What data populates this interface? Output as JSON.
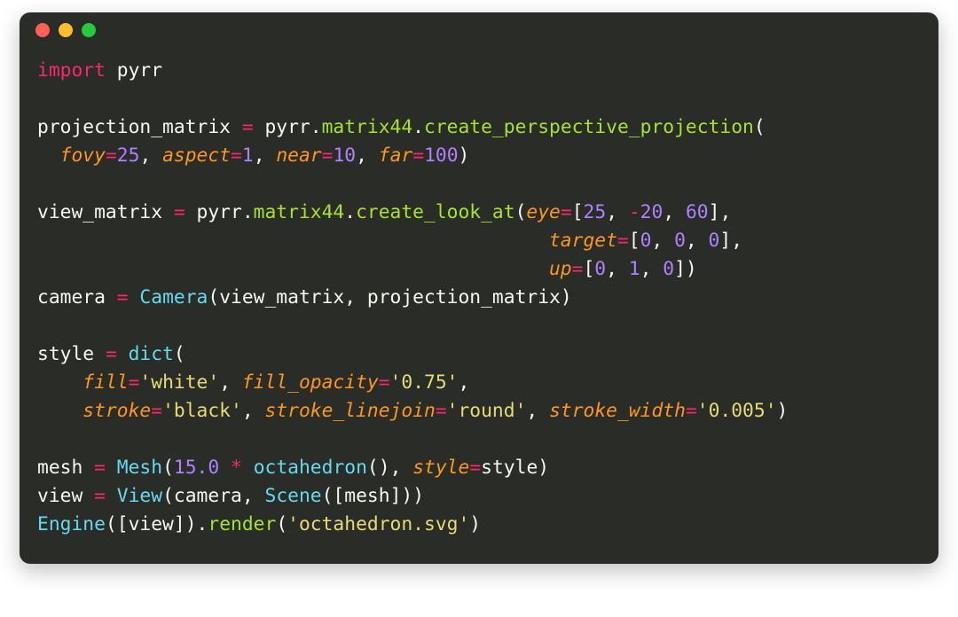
{
  "window": {
    "dots": [
      "red",
      "yellow",
      "green"
    ]
  },
  "code": {
    "kw_import": "import",
    "mod_pyrr": "pyrr",
    "var_projection": "projection_matrix",
    "op_eq": "=",
    "pyrr_ref": "pyrr",
    "dot": ".",
    "attr_matrix44": "matrix44",
    "call_create_perspective": "create_perspective_projection",
    "open_paren": "(",
    "close_paren": ")",
    "comma_sp": ", ",
    "param_fovy": "fovy",
    "num_25": "25",
    "param_aspect": "aspect",
    "num_1": "1",
    "param_near": "near",
    "num_10": "10",
    "param_far": "far",
    "num_100": "100",
    "var_view": "view_matrix",
    "call_create_lookat": "create_look_at",
    "param_eye": "eye",
    "bracket_open": "[",
    "bracket_close": "]",
    "num_neg20": "-20",
    "num_60": "60",
    "pad_target": "                                             ",
    "param_target": "target",
    "num_0": "0",
    "pad_up": "                                             ",
    "param_up": "up",
    "var_camera": "camera",
    "cls_Camera": "Camera",
    "var_style": "style",
    "call_dict": "dict",
    "indent_style": "    ",
    "param_fill": "fill",
    "str_white": "'white'",
    "param_fill_opacity": "fill_opacity",
    "str_075": "'0.75'",
    "param_stroke": "stroke",
    "str_black": "'black'",
    "param_stroke_linejoin": "stroke_linejoin",
    "str_round": "'round'",
    "param_stroke_width": "stroke_width",
    "str_0005": "'0.005'",
    "var_mesh": "mesh",
    "cls_Mesh": "Mesh",
    "num_15f": "15.0",
    "op_star": "*",
    "call_octahedron": "octahedron",
    "param_style_kw": "style",
    "var_style_ref": "style",
    "var_view2": "view",
    "cls_View": "View",
    "cls_Scene": "Scene",
    "cls_Engine": "Engine",
    "attr_render": "render",
    "str_octsvg": "'octahedron.svg'",
    "indent2": "  "
  }
}
